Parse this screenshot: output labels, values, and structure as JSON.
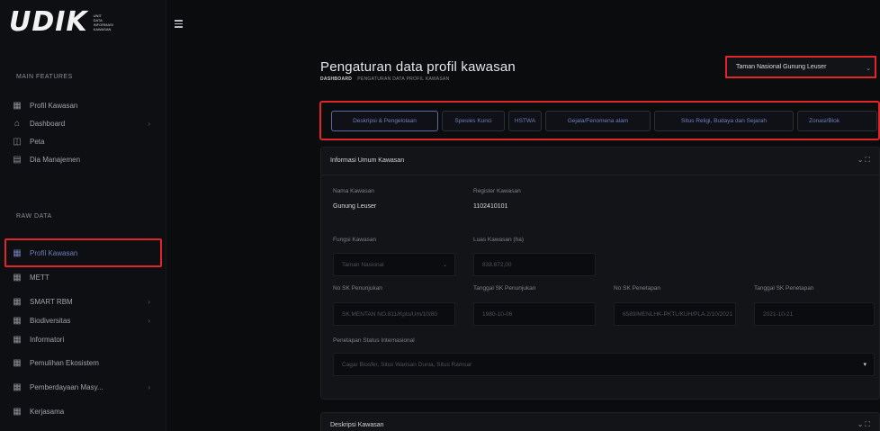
{
  "app": {
    "logo_text": "UDIK",
    "logo_sub": [
      "UNIT",
      "DATA",
      "INFORMASI",
      "KAWASAN"
    ]
  },
  "sidebar": {
    "main_features_label": "MAIN FEATURES",
    "main_items": [
      {
        "label": "Profil Kawasan",
        "icon": "grid-icon"
      },
      {
        "label": "Dashboard",
        "icon": "dashboard-icon"
      },
      {
        "label": "Peta",
        "icon": "map-icon"
      },
      {
        "label": "Dia Manajemen",
        "icon": "calendar-icon"
      }
    ],
    "raw_data_label": "RAW DATA",
    "raw_items": [
      {
        "label": "Profil Kawasan",
        "icon": "grid-icon",
        "active": true
      },
      {
        "label": "METT",
        "icon": "grid-icon"
      },
      {
        "label": "SMART RBM",
        "icon": "grid-icon"
      },
      {
        "label": "Biodiversitas",
        "icon": "grid-icon"
      },
      {
        "label": "Informatori",
        "icon": "grid-icon"
      },
      {
        "label": "Pemulihan Ekosistem",
        "icon": "grid-icon"
      },
      {
        "label": "Pemberdayaan Masy...",
        "icon": "grid-icon"
      },
      {
        "label": "Kerjasama",
        "icon": "grid-icon"
      }
    ]
  },
  "header": {
    "title": "Pengaturan data profil kawasan",
    "breadcrumb_home": "DASHBOARD",
    "breadcrumb_current": "PENGATURAN DATA PROFIL KAWASAN",
    "park_select": "Taman Nasional Gunung Leuser"
  },
  "tabs": [
    "Deskripsi & Pengelolaan",
    "Spesies Kunci",
    "HSTWA",
    "Gejala/Fenomena alam",
    "Situs Religi, Budaya dan Sejarah",
    "Zonasi/Blok"
  ],
  "card_general": {
    "title": "Informasi Umum Kawasan",
    "nama_label": "Nama Kawasan",
    "nama_value": "Gunung Leuser",
    "register_label": "Register Kawasan",
    "register_value": "1102410101",
    "fungsi_label": "Fungsi Kawasan",
    "fungsi_value": "Taman Nasional",
    "luas_label": "Luas Kawasan (ha)",
    "luas_value": "838.872,00",
    "sk_penunjukan_label": "No SK Penunjukan",
    "sk_penunjukan_value": "SK.MENTAN NO.811/Kpts/Um/10/80",
    "tgl_sk_penunjukan_label": "Tanggal SK Penunjukan",
    "tgl_sk_penunjukan_value": "1980-10-06",
    "sk_penetapan_label": "No SK Penetapan",
    "sk_penetapan_value": "6589/MENLHK-PKTL/KUH/PLA.2/10/2021",
    "tgl_sk_penetapan_label": "Tanggal SK Penetapan",
    "tgl_sk_penetapan_value": "2021-10-21",
    "status_label": "Penetapan Status Internasional",
    "status_placeholder": "Cagar Biosfer, Situs Warisan Dunia, Situs Ramsar"
  },
  "card_desc": {
    "title": "Deskripsi Kawasan"
  },
  "colors": {
    "accent": "#6e7dbb",
    "highlight": "#e0252b",
    "bg": "#0b0c0e",
    "card": "#131418"
  }
}
